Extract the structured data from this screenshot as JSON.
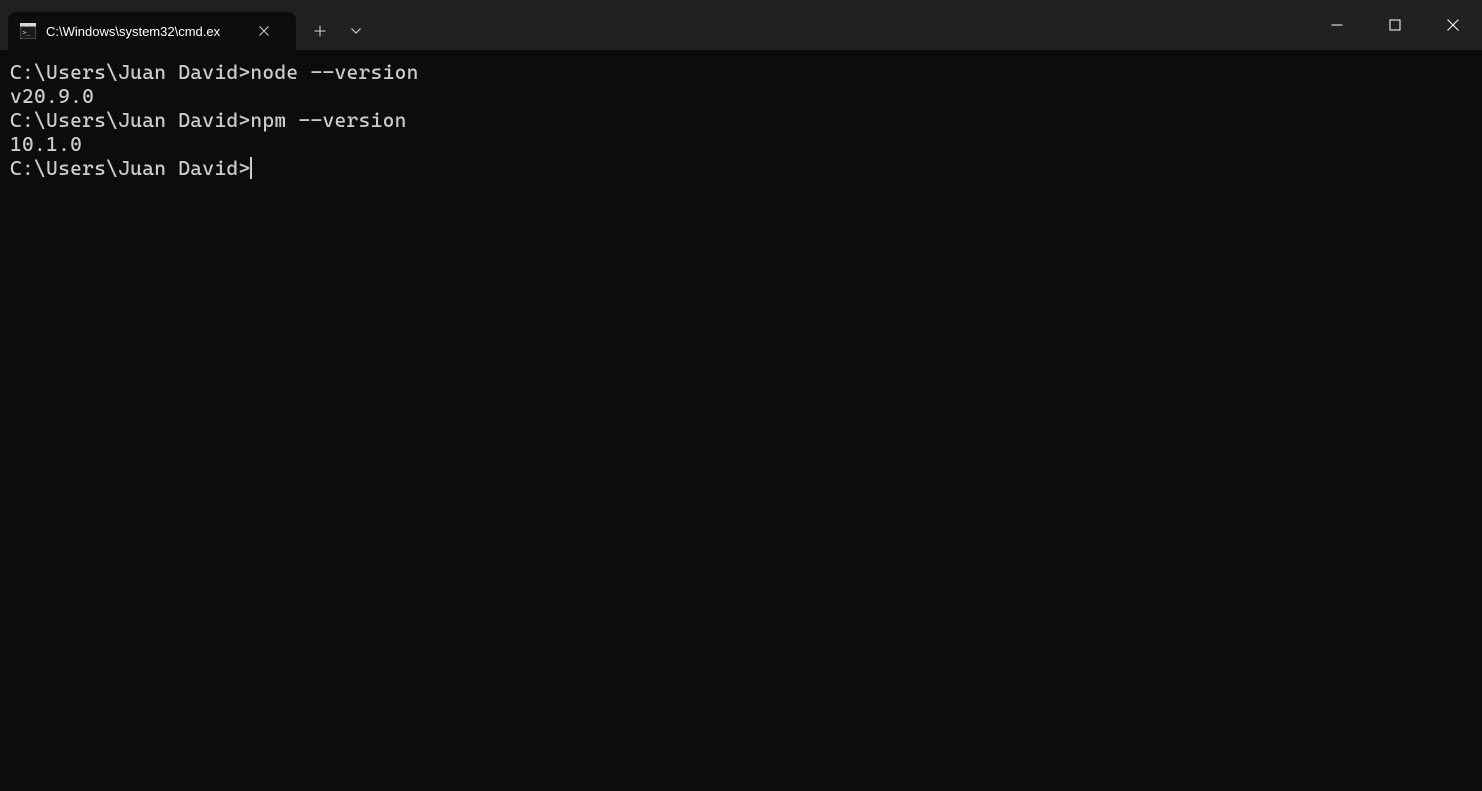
{
  "tab": {
    "title": "C:\\Windows\\system32\\cmd.ex"
  },
  "terminal": {
    "lines": [
      "C:\\Users\\Juan David>node --version",
      "v20.9.0",
      "",
      "C:\\Users\\Juan David>npm --version",
      "10.1.0",
      ""
    ],
    "current_prompt": "C:\\Users\\Juan David>"
  }
}
